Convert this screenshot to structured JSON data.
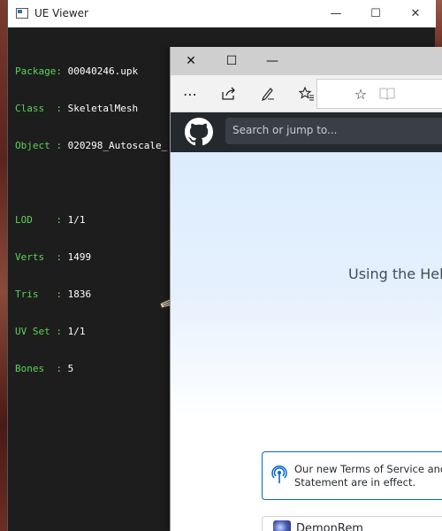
{
  "ue_viewer": {
    "title": "UE Viewer",
    "controls": {
      "minimize": "—",
      "maximize": "☐",
      "close": "✕"
    },
    "info": [
      {
        "key": "Package:",
        "value": "00040246.upk"
      },
      {
        "key": "Class  :",
        "value": "SkeletalMesh"
      },
      {
        "key": "Object :",
        "value": "020298_Autoscale_"
      }
    ],
    "stats": [
      {
        "key": "LOD    :",
        "value": "1/1"
      },
      {
        "key": "Verts  :",
        "value": "1499"
      },
      {
        "key": "Tris   :",
        "value": "1836"
      },
      {
        "key": "UV Set :",
        "value": "1/1"
      },
      {
        "key": "Bones  :",
        "value": "5"
      }
    ],
    "colors": {
      "key": "#5bd35b",
      "value": "#ffffff",
      "background": "#1d1d1d"
    }
  },
  "edge": {
    "controls": {
      "close": "✕",
      "maximize": "☐",
      "minimize": "—"
    },
    "toolbar": {
      "more": "⋯",
      "share": "share-icon",
      "notes": "pen-icon",
      "favorites": "favorites-list-icon",
      "add_favorite": "☆",
      "reading_view": "reading-view-icon"
    },
    "github": {
      "search_placeholder": "Search or jump to...",
      "hero_text": "Using the Hel",
      "notice_text": "Our new Terms of Service and P\nStatement are in effect.",
      "card_name": "DemonRem"
    }
  }
}
